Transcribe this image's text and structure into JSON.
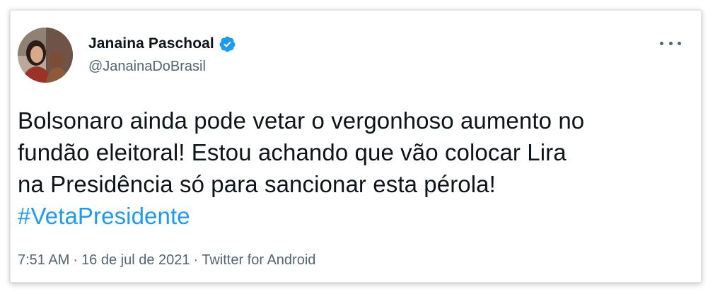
{
  "tweet": {
    "author": {
      "display_name": "Janaina Paschoal",
      "handle": "@JanainaDoBrasil",
      "verified": true,
      "avatar_icon": "profile-photo"
    },
    "more_icon": "more-horizontal-icon",
    "text_lines": [
      "Bolsonaro ainda pode vetar o vergonhoso aumento no",
      "fundão eleitoral! Estou achando que vão colocar Lira",
      "na Presidência só para sancionar esta pérola!"
    ],
    "hashtag": "#VetaPresidente",
    "time": "7:51 AM",
    "date": "16 de jul de 2021",
    "source": "Twitter for Android",
    "separator": "·"
  },
  "colors": {
    "text": "#0f1419",
    "secondary": "#536471",
    "link": "#1d9bf0",
    "verified": "#1d9bf0",
    "border": "#dfe3e6"
  }
}
